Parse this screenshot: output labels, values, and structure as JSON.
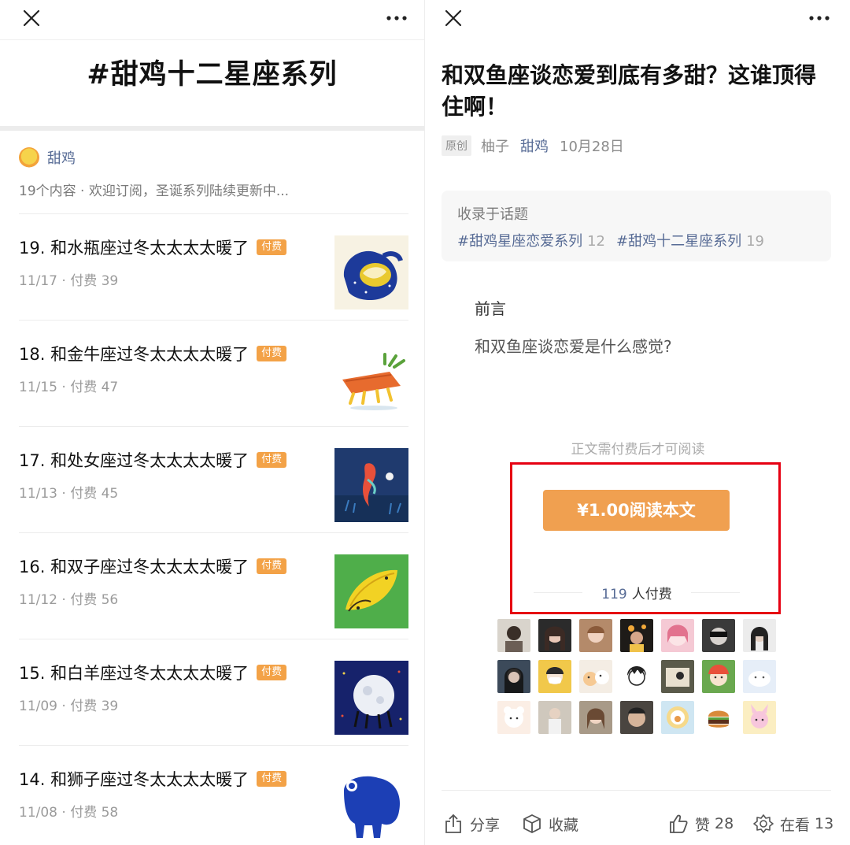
{
  "left": {
    "title": "#甜鸡十二星座系列",
    "author": "甜鸡",
    "meta": "19个内容 · 欢迎订阅，圣诞系列陆续更新中...",
    "paid_tag": "付费",
    "items": [
      {
        "title": "19. 和水瓶座过冬太太太太暖了",
        "meta": "11/17 · 付费 39"
      },
      {
        "title": "18. 和金牛座过冬太太太太暖了",
        "meta": "11/15 · 付费 47"
      },
      {
        "title": "17. 和处女座过冬太太太太暖了",
        "meta": "11/13 · 付费 45"
      },
      {
        "title": "16. 和双子座过冬太太太太暖了",
        "meta": "11/12 · 付费 56"
      },
      {
        "title": "15. 和白羊座过冬太太太太暖了",
        "meta": "11/09 · 付费 39"
      },
      {
        "title": "14. 和狮子座过冬太太太太暖了",
        "meta": "11/08 · 付费 58"
      }
    ]
  },
  "right": {
    "title": "和双鱼座谈恋爱到底有多甜？这谁顶得住啊！",
    "original_tag": "原创",
    "author": "柚子",
    "account": "甜鸡",
    "date": "10月28日",
    "topic_label": "收录于话题",
    "topics": [
      {
        "name": "#甜鸡星座恋爱系列",
        "count": "12"
      },
      {
        "name": "#甜鸡十二星座系列",
        "count": "19"
      }
    ],
    "preface_heading": "前言",
    "preface_text": "和双鱼座谈恋爱是什么感觉?",
    "paywall_note": "正文需付费后才可阅读",
    "pay_button": "¥1.00阅读本文",
    "payers_count": "119",
    "payers_label": "人付费",
    "bottom": {
      "share": "分享",
      "favorite": "收藏",
      "like": "赞",
      "like_count": "28",
      "watching": "在看",
      "watching_count": "13"
    }
  },
  "colors": {
    "link": "#576b95",
    "pay_orange": "#f0a050",
    "tag_orange": "#f3a247",
    "highlight_red": "#e60012"
  }
}
